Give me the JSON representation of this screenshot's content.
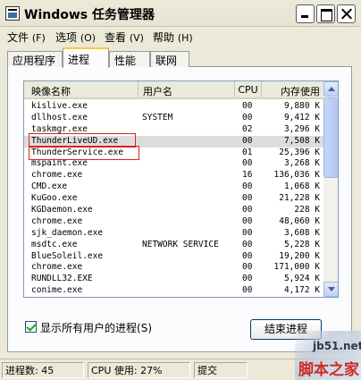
{
  "window": {
    "title": "Windows 任务管理器"
  },
  "menu": {
    "file": "文件",
    "file_key": "(F)",
    "options": "选项",
    "options_key": "(O)",
    "view": "查看",
    "view_key": "(V)",
    "help": "帮助",
    "help_key": "(H)"
  },
  "tabs": {
    "apps": "应用程序",
    "processes": "进程",
    "performance": "性能",
    "network": "联网"
  },
  "table": {
    "headers": {
      "name": "映像名称",
      "user": "用户名",
      "cpu": "CPU",
      "mem": "内存使用"
    },
    "rows": [
      {
        "name": "kislive.exe",
        "user": "",
        "cpu": "00",
        "mem": "9,880 K"
      },
      {
        "name": "dllhost.exe",
        "user": "SYSTEM",
        "cpu": "00",
        "mem": "9,412 K"
      },
      {
        "name": "taskmgr.exe",
        "user": "",
        "cpu": "02",
        "mem": "3,296 K"
      },
      {
        "name": "ThunderLiveUD.exe",
        "user": "",
        "cpu": "00",
        "mem": "7,508 K"
      },
      {
        "name": "ThunderService.exe",
        "user": "",
        "cpu": "01",
        "mem": "25,396 K"
      },
      {
        "name": "mspaint.exe",
        "user": "",
        "cpu": "00",
        "mem": "3,268 K"
      },
      {
        "name": "chrome.exe",
        "user": "",
        "cpu": "16",
        "mem": "136,036 K"
      },
      {
        "name": "CMD.exe",
        "user": "",
        "cpu": "00",
        "mem": "1,068 K"
      },
      {
        "name": "KuGoo.exe",
        "user": "",
        "cpu": "00",
        "mem": "21,228 K"
      },
      {
        "name": "KGDaemon.exe",
        "user": "",
        "cpu": "00",
        "mem": "228 K"
      },
      {
        "name": "chrome.exe",
        "user": "",
        "cpu": "00",
        "mem": "48,060 K"
      },
      {
        "name": "sjk_daemon.exe",
        "user": "",
        "cpu": "00",
        "mem": "3,608 K"
      },
      {
        "name": "msdtc.exe",
        "user": "NETWORK SERVICE",
        "cpu": "00",
        "mem": "5,228 K"
      },
      {
        "name": "BlueSoleil.exe",
        "user": "",
        "cpu": "00",
        "mem": "19,200 K"
      },
      {
        "name": "chrome.exe",
        "user": "",
        "cpu": "00",
        "mem": "171,000 K"
      },
      {
        "name": "RUNDLL32.EXE",
        "user": "",
        "cpu": "00",
        "mem": "5,924 K"
      },
      {
        "name": "conime.exe",
        "user": "",
        "cpu": "00",
        "mem": "4,172 K"
      }
    ]
  },
  "show_all_users": {
    "label": "显示所有用户的进程",
    "key": "(S)",
    "checked": true
  },
  "end_process_button": "结束进程",
  "status": {
    "processes": "进程数: 45",
    "cpu": "CPU 使用: 27%",
    "commit": "提交"
  },
  "watermark": {
    "site": "jb51.net",
    "name": "脚本之家"
  }
}
